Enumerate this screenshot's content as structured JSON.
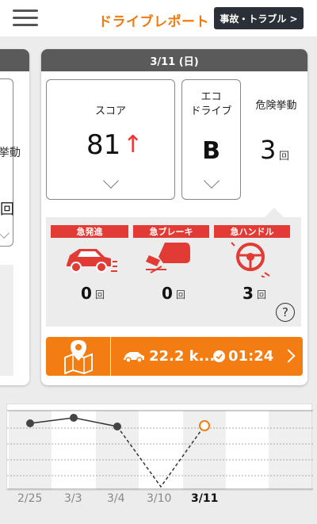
{
  "header": {
    "title": "ドライブレポート",
    "trouble_button": "事故・トラブル >"
  },
  "prev_card": {
    "partial_label": "挙動",
    "partial_value": "回"
  },
  "card": {
    "date": "3/11 (日)",
    "score": {
      "label": "スコア",
      "value": "81",
      "trend": "↑"
    },
    "eco": {
      "label_line1": "エコ",
      "label_line2": "ドライブ",
      "value": "B"
    },
    "danger": {
      "label": "危険挙動",
      "value": "3",
      "unit": "回"
    },
    "categories": [
      {
        "label": "急発進",
        "count": "0",
        "unit": "回",
        "icon": "car-icon"
      },
      {
        "label": "急ブレーキ",
        "count": "0",
        "unit": "回",
        "icon": "brake-pedal-icon"
      },
      {
        "label": "急ハンドル",
        "count": "3",
        "unit": "回",
        "icon": "steering-wheel-icon"
      }
    ],
    "help": "?",
    "route": {
      "distance": "22.2 k...",
      "time": "01:24"
    }
  },
  "graph": {
    "dates": [
      "2/25",
      "3/3",
      "3/4",
      "3/10",
      "3/11"
    ],
    "active_index": 4
  },
  "colors": {
    "accent": "#f37d12",
    "danger": "#e23b36",
    "header_bar": "#5a5a5a"
  }
}
